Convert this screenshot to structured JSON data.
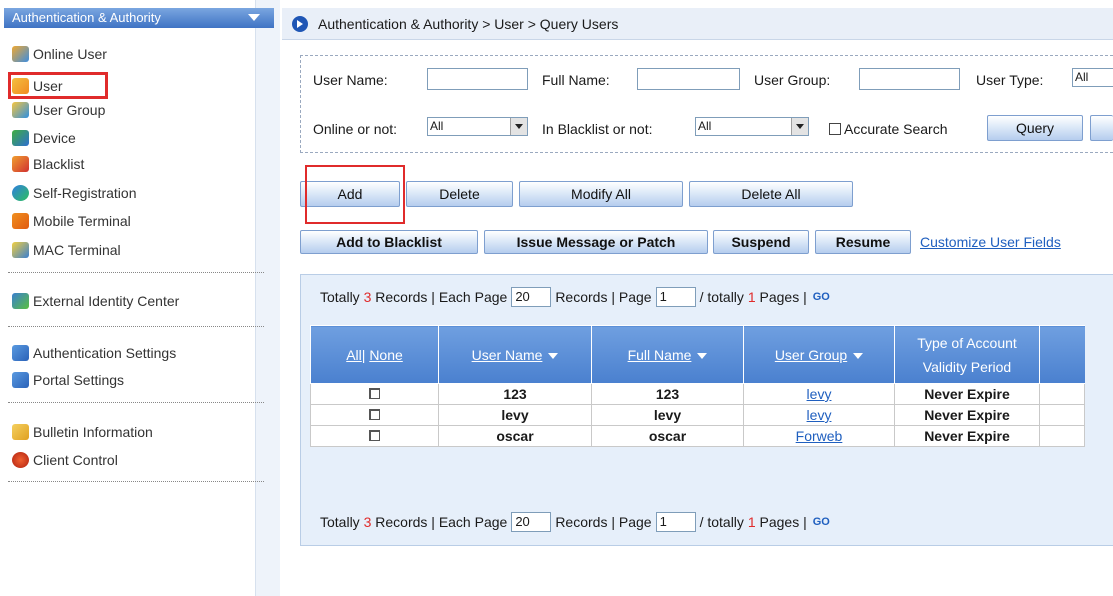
{
  "sidebar": {
    "header": "Authentication & Authority",
    "items": [
      {
        "label": "Online User",
        "icon": "online-user-icon"
      },
      {
        "label": "User",
        "icon": "user-icon"
      },
      {
        "label": "User Group",
        "icon": "user-group-icon"
      },
      {
        "label": "Device",
        "icon": "device-icon"
      },
      {
        "label": "Blacklist",
        "icon": "blacklist-icon"
      },
      {
        "label": "Self-Registration",
        "icon": "self-registration-icon"
      },
      {
        "label": "Mobile Terminal",
        "icon": "mobile-terminal-icon"
      },
      {
        "label": "MAC Terminal",
        "icon": "mac-terminal-icon"
      },
      {
        "label": "External Identity Center",
        "icon": "external-identity-center-icon"
      },
      {
        "label": "Authentication Settings",
        "icon": "authentication-settings-icon"
      },
      {
        "label": "Portal Settings",
        "icon": "portal-settings-icon"
      },
      {
        "label": "Bulletin Information",
        "icon": "bulletin-information-icon"
      },
      {
        "label": "Client Control",
        "icon": "client-control-icon"
      }
    ]
  },
  "breadcrumb": "Authentication & Authority > User > Query Users",
  "search": {
    "user_name_label": "User Name:",
    "full_name_label": "Full Name:",
    "user_group_label": "User Group:",
    "user_type_label": "User Type:",
    "user_type_value": "All",
    "online_label": "Online or not:",
    "online_value": "All",
    "blacklist_label": "In Blacklist or not:",
    "blacklist_value": "All",
    "accurate_label": "Accurate Search",
    "query_label": "Query"
  },
  "toolbar": {
    "add": "Add",
    "delete": "Delete",
    "modify_all": "Modify All",
    "delete_all": "Delete All",
    "add_to_blacklist": "Add to Blacklist",
    "issue_message": "Issue Message or Patch",
    "suspend": "Suspend",
    "resume": "Resume",
    "customize": "Customize User Fields"
  },
  "pager": {
    "totally": "Totally",
    "records_count": "3",
    "each_page": "Records | Each Page",
    "page_size": "20",
    "records_page": "Records | Page",
    "page": "1",
    "totally_pages_prefix": "/ totally",
    "pages_count": "1",
    "pages_suffix": "Pages |",
    "go": "GO"
  },
  "table": {
    "col_all": "All",
    "col_none": "None",
    "col_user_name": "User Name",
    "col_full_name": "Full Name",
    "col_user_group": "User Group",
    "col_type_1": "Type of Account",
    "col_type_2": "Validity Period",
    "rows": [
      {
        "user_name": "123",
        "full_name": "123",
        "user_group": "levy",
        "validity": "Never Expire"
      },
      {
        "user_name": "levy",
        "full_name": "levy",
        "user_group": "levy",
        "validity": "Never Expire"
      },
      {
        "user_name": "oscar",
        "full_name": "oscar",
        "user_group": "Forweb",
        "validity": "Never Expire"
      }
    ]
  },
  "colors": {
    "accent": "#4a80cf",
    "highlight": "#e02b2b",
    "link": "#1f5fbf"
  }
}
